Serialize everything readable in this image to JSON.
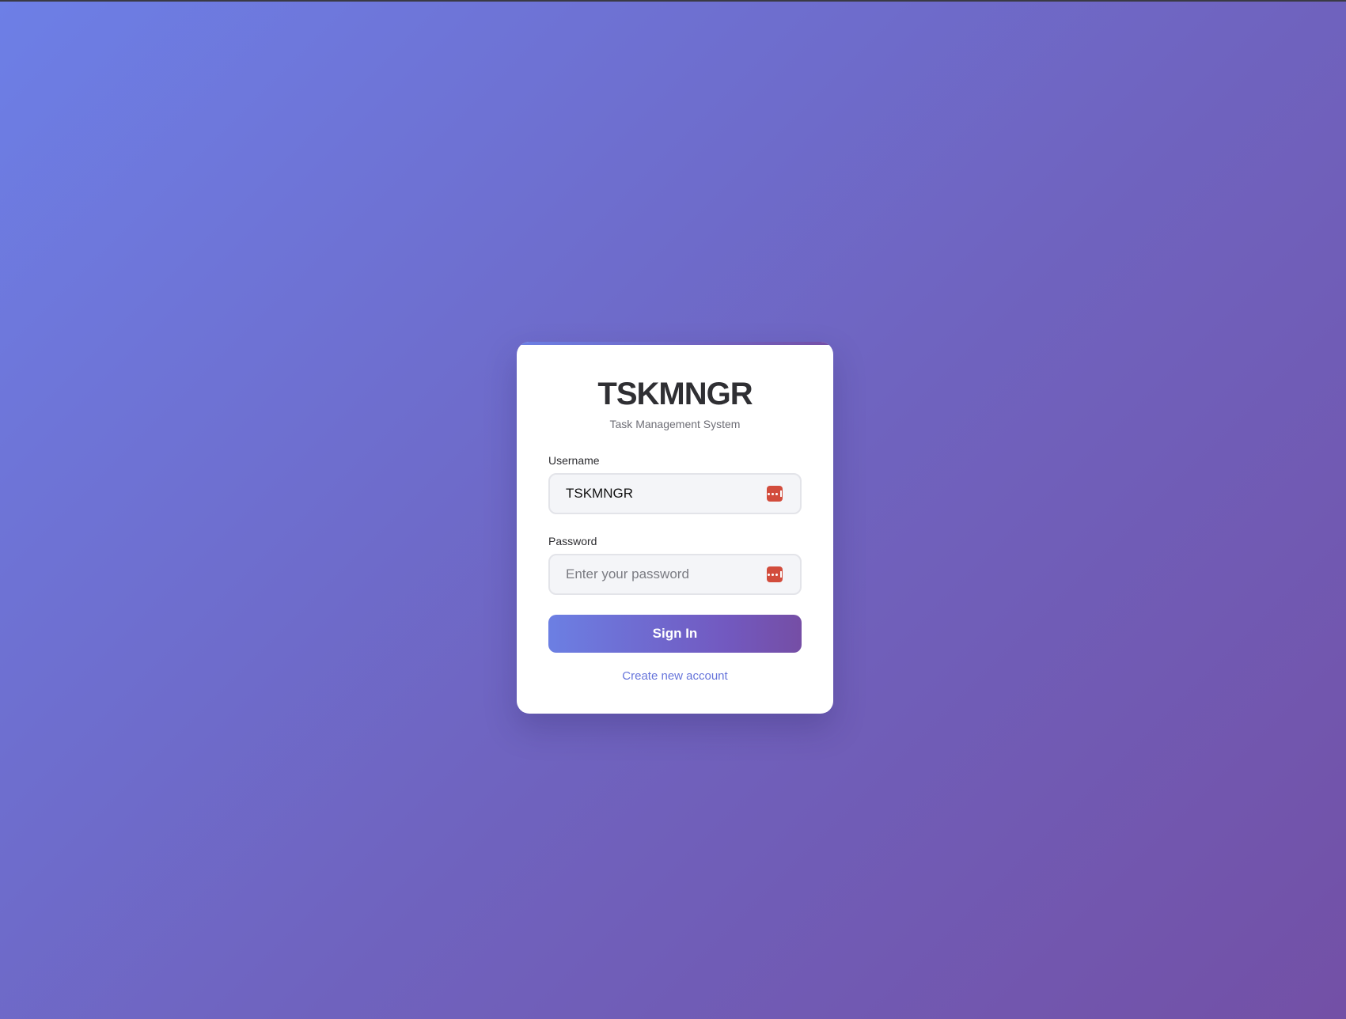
{
  "colors": {
    "background_start": "#6d7fe6",
    "background_end": "#7350a6",
    "accent": "#6674db",
    "password_icon": "#d24c3c"
  },
  "login_card": {
    "brand": "TSKMNGR",
    "subtitle": "Task Management System",
    "username": {
      "label": "Username",
      "value": "TSKMNGR",
      "icon": "password-manager-icon"
    },
    "password": {
      "label": "Password",
      "value": "",
      "placeholder": "Enter your password",
      "icon": "password-manager-icon"
    },
    "sign_in_label": "Sign In",
    "create_account_label": "Create new account"
  }
}
